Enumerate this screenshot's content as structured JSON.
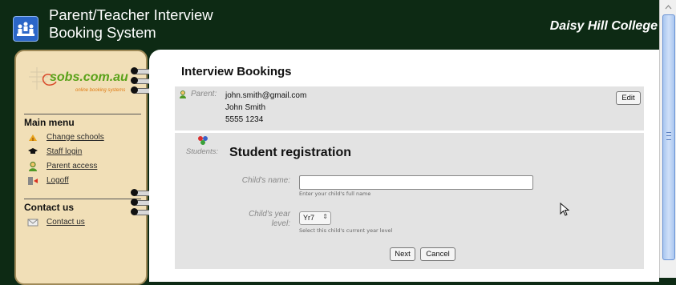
{
  "header": {
    "title_line1": "Parent/Teacher Interview",
    "title_line2": "Booking System",
    "college": "Daisy Hill College"
  },
  "sidebar": {
    "logo_text": "sobs.com.au",
    "logo_tagline": "online booking systems",
    "main_menu_heading": "Main menu",
    "items": [
      {
        "label": "Change schools",
        "icon": "school-icon"
      },
      {
        "label": "Staff login",
        "icon": "graduation-cap-icon"
      },
      {
        "label": "Parent access",
        "icon": "person-icon"
      },
      {
        "label": "Logoff",
        "icon": "logoff-door-icon"
      }
    ],
    "contact_heading": "Contact us",
    "contact_item": "Contact us"
  },
  "main": {
    "title": "Interview Bookings",
    "parent_label": "Parent:",
    "parent_email": "john.smith@gmail.com",
    "parent_name": "John Smith",
    "parent_phone": "5555 1234",
    "edit_button": "Edit",
    "students_label": "Students:",
    "registration_title": "Student registration",
    "child_name_label": "Child's name:",
    "child_name_value": "",
    "child_name_hint": "Enter your child's full name",
    "year_label_line1": "Child's year",
    "year_label_line2": "level:",
    "year_selected": "Yr7",
    "year_hint": "Select this child's current year level",
    "next_button": "Next",
    "cancel_button": "Cancel"
  },
  "colors": {
    "header_bg": "#0d2a14",
    "sidebar_bg": "#f1dfb7",
    "panel_bg": "#e3e3e3",
    "logo_green": "#5aa21a",
    "scrollbar_thumb": "#a9c6f0"
  }
}
